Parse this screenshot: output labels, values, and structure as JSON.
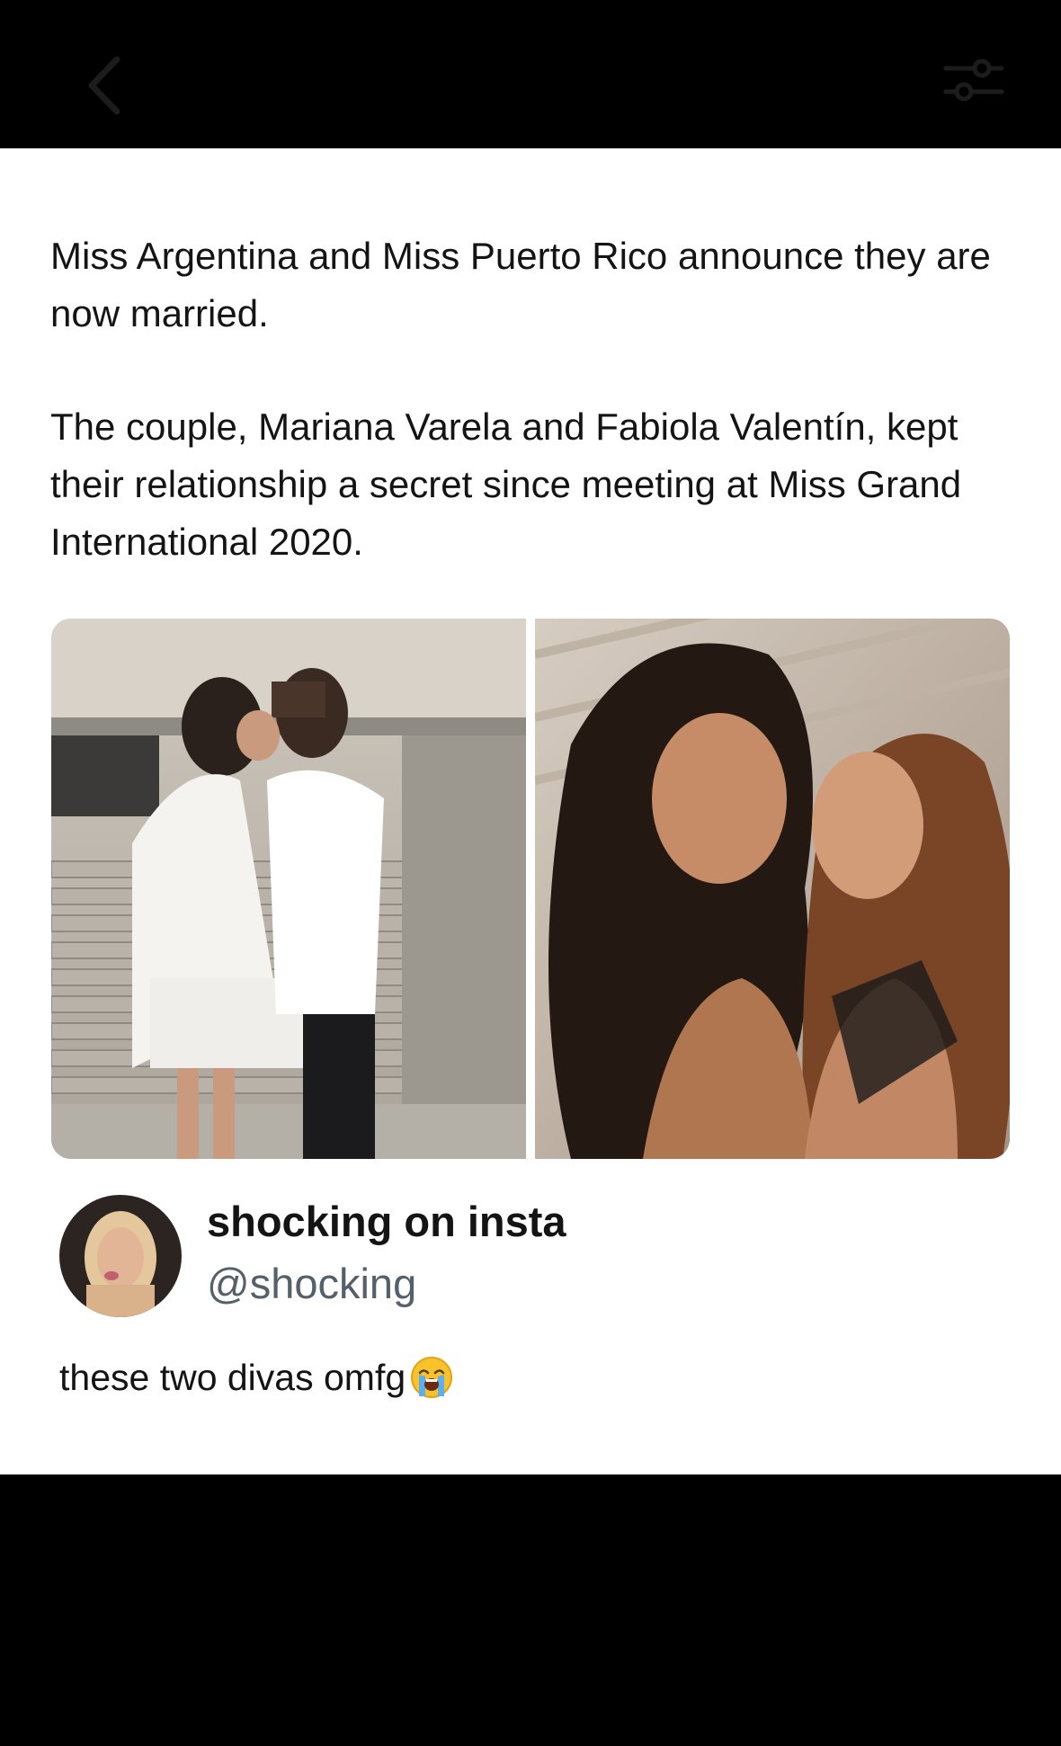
{
  "post": {
    "headline": "Miss Argentina and Miss Puerto Rico announce they are now married.",
    "detail": "The couple, Mariana Varela and Fabiola Valentín, kept their relationship a secret since meeting at Miss Grand International 2020."
  },
  "quote": {
    "display_name": "shocking on insta",
    "handle": "@shocking",
    "comment": "these two divas omfg",
    "comment_emoji": "loudly-crying-face-icon"
  },
  "colors": {
    "background": "#ffffff",
    "bars": "#000000",
    "text": "#141414",
    "handle": "#55606a"
  }
}
